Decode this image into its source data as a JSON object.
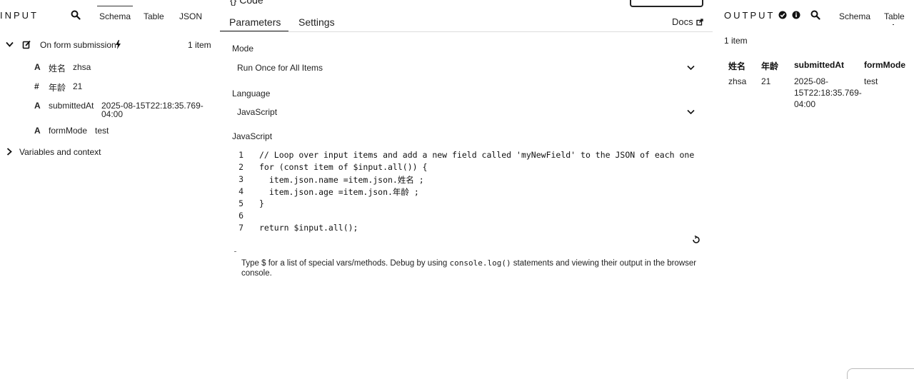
{
  "input_panel": {
    "title": "INPUT",
    "tabs": [
      "Schema",
      "Table",
      "JSON"
    ],
    "active_tab": "Schema",
    "node": {
      "label": "On form submission",
      "count": "1 item"
    },
    "fields": [
      {
        "type": "A",
        "name": "姓名",
        "value": "zhsa"
      },
      {
        "type": "#",
        "name": "年龄",
        "value": "21"
      },
      {
        "type": "A",
        "name": "submittedAt",
        "value_line1": "2025-08-15T22:18:35.769-",
        "value_line2": "04:00"
      },
      {
        "type": "A",
        "name": "formMode",
        "value": "test"
      }
    ],
    "variables_label": "Variables and context"
  },
  "center_panel": {
    "node_title": "{} Code",
    "tabs": [
      "Parameters",
      "Settings"
    ],
    "active_tab": "Parameters",
    "docs_label": "Docs",
    "mode_label": "Mode",
    "mode_value": "Run Once for All Items",
    "language_label": "Language",
    "language_value": "JavaScript",
    "code_label": "JavaScript",
    "code_lines": [
      {
        "no": "1",
        "text": "// Loop over input items and add a new field called 'myNewField' to the JSON of each one"
      },
      {
        "no": "2",
        "text": "for (const item of $input.all()) {"
      },
      {
        "no": "3",
        "text": "  item.json.name =item.json.姓名 ;"
      },
      {
        "no": "4",
        "text": "  item.json.age =item.json.年龄 ;"
      },
      {
        "no": "5",
        "text": "}"
      },
      {
        "no": "6",
        "text": ""
      },
      {
        "no": "7",
        "text": "return $input.all();"
      }
    ],
    "hint_prefix": "Type $ for a list of special vars/methods. Debug by using ",
    "hint_code": "console.log()",
    "hint_suffix": " statements and viewing their output in the browser console."
  },
  "output_panel": {
    "title": "OUTPUT",
    "tabs": [
      "Schema",
      "Table"
    ],
    "active_tab": "Table",
    "count": "1 item",
    "columns": [
      "姓名",
      "年龄",
      "submittedAt",
      "formMode"
    ],
    "row": {
      "c1": "zhsa",
      "c2": "21",
      "c3_line1": "2025-08-",
      "c3_line2": "15T22:18:35.769-",
      "c3_line3": "04:00",
      "c4": "test"
    }
  }
}
